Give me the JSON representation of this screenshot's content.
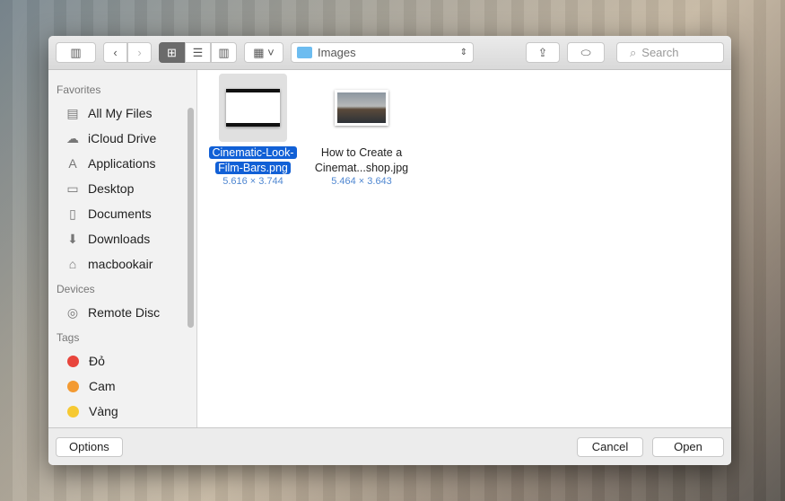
{
  "toolbar": {
    "path": "Images",
    "search_placeholder": "Search"
  },
  "sidebar": {
    "favorites_header": "Favorites",
    "favorites": [
      {
        "label": "All My Files",
        "icon": "▤"
      },
      {
        "label": "iCloud Drive",
        "icon": "☁"
      },
      {
        "label": "Applications",
        "icon": "A"
      },
      {
        "label": "Desktop",
        "icon": "▭"
      },
      {
        "label": "Documents",
        "icon": "▯"
      },
      {
        "label": "Downloads",
        "icon": "⬇"
      },
      {
        "label": "macbookair",
        "icon": "⌂"
      }
    ],
    "devices_header": "Devices",
    "devices": [
      {
        "label": "Remote Disc",
        "icon": "◎"
      }
    ],
    "tags_header": "Tags",
    "tags": [
      {
        "label": "Đỏ",
        "color": "#e8453c"
      },
      {
        "label": "Cam",
        "color": "#f39a32"
      },
      {
        "label": "Vàng",
        "color": "#f6c932"
      }
    ]
  },
  "files": [
    {
      "name_line1": "Cinematic-Look-",
      "name_line2": "Film-Bars.png",
      "dims": "5.616 × 3.744",
      "selected": true
    },
    {
      "name_line1": "How to Create a",
      "name_line2": "Cinemat...shop.jpg",
      "dims": "5.464 × 3.643",
      "selected": false
    }
  ],
  "footer": {
    "options": "Options",
    "cancel": "Cancel",
    "open": "Open"
  }
}
